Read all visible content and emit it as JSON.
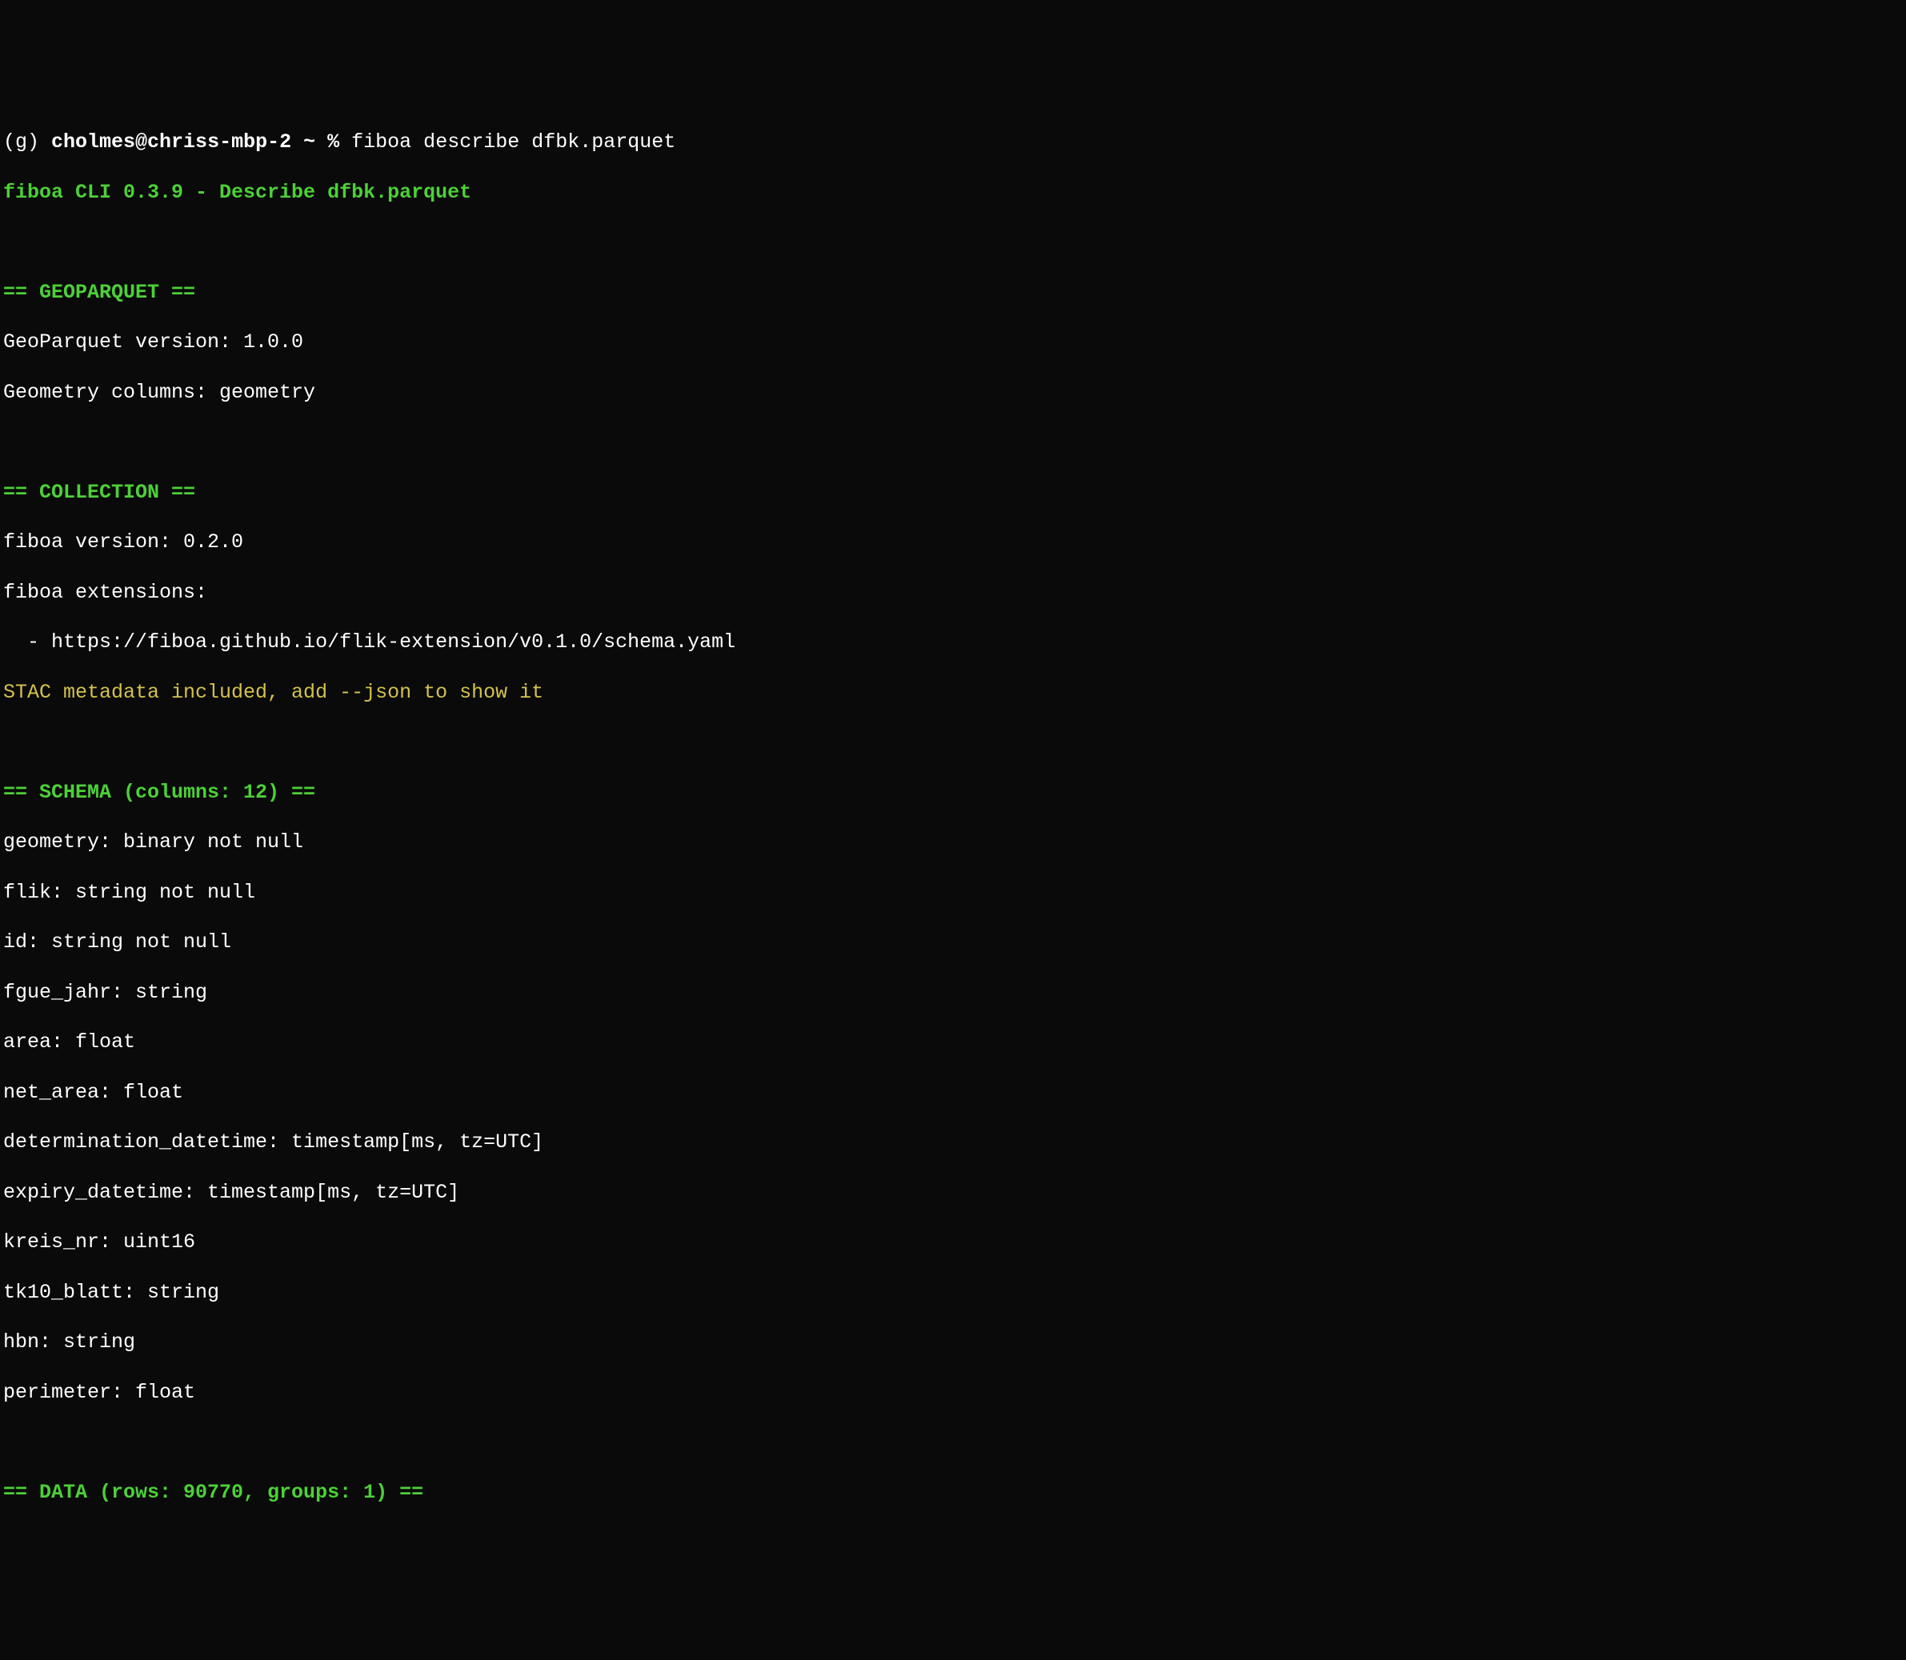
{
  "prompt": {
    "env": "(g)",
    "user_host": "cholmes@chriss-mbp-2",
    "path": "~",
    "symbol": "%",
    "command": "fiboa describe dfbk.parquet"
  },
  "cli_title": "fiboa CLI 0.3.9 - Describe dfbk.parquet",
  "sections": {
    "geoparquet": {
      "header": "== GEOPARQUET ==",
      "lines": [
        "GeoParquet version: 1.0.0",
        "Geometry columns: geometry"
      ]
    },
    "collection": {
      "header": "== COLLECTION ==",
      "lines": [
        "fiboa version: 0.2.0",
        "fiboa extensions:",
        "  - https://fiboa.github.io/flik-extension/v0.1.0/schema.yaml"
      ],
      "highlight": "STAC metadata included, add --json to show it"
    },
    "schema": {
      "header": "== SCHEMA (columns: 12) ==",
      "columns": [
        "geometry: binary not null",
        "flik: string not null",
        "id: string not null",
        "fgue_jahr: string",
        "area: float",
        "net_area: float",
        "determination_datetime: timestamp[ms, tz=UTC]",
        "expiry_datetime: timestamp[ms, tz=UTC]",
        "kreis_nr: uint16",
        "tk10_blatt: string",
        "hbn: string",
        "perimeter: float"
      ]
    },
    "data": {
      "header": "== DATA (rows: 90770, groups: 1) =="
    }
  }
}
